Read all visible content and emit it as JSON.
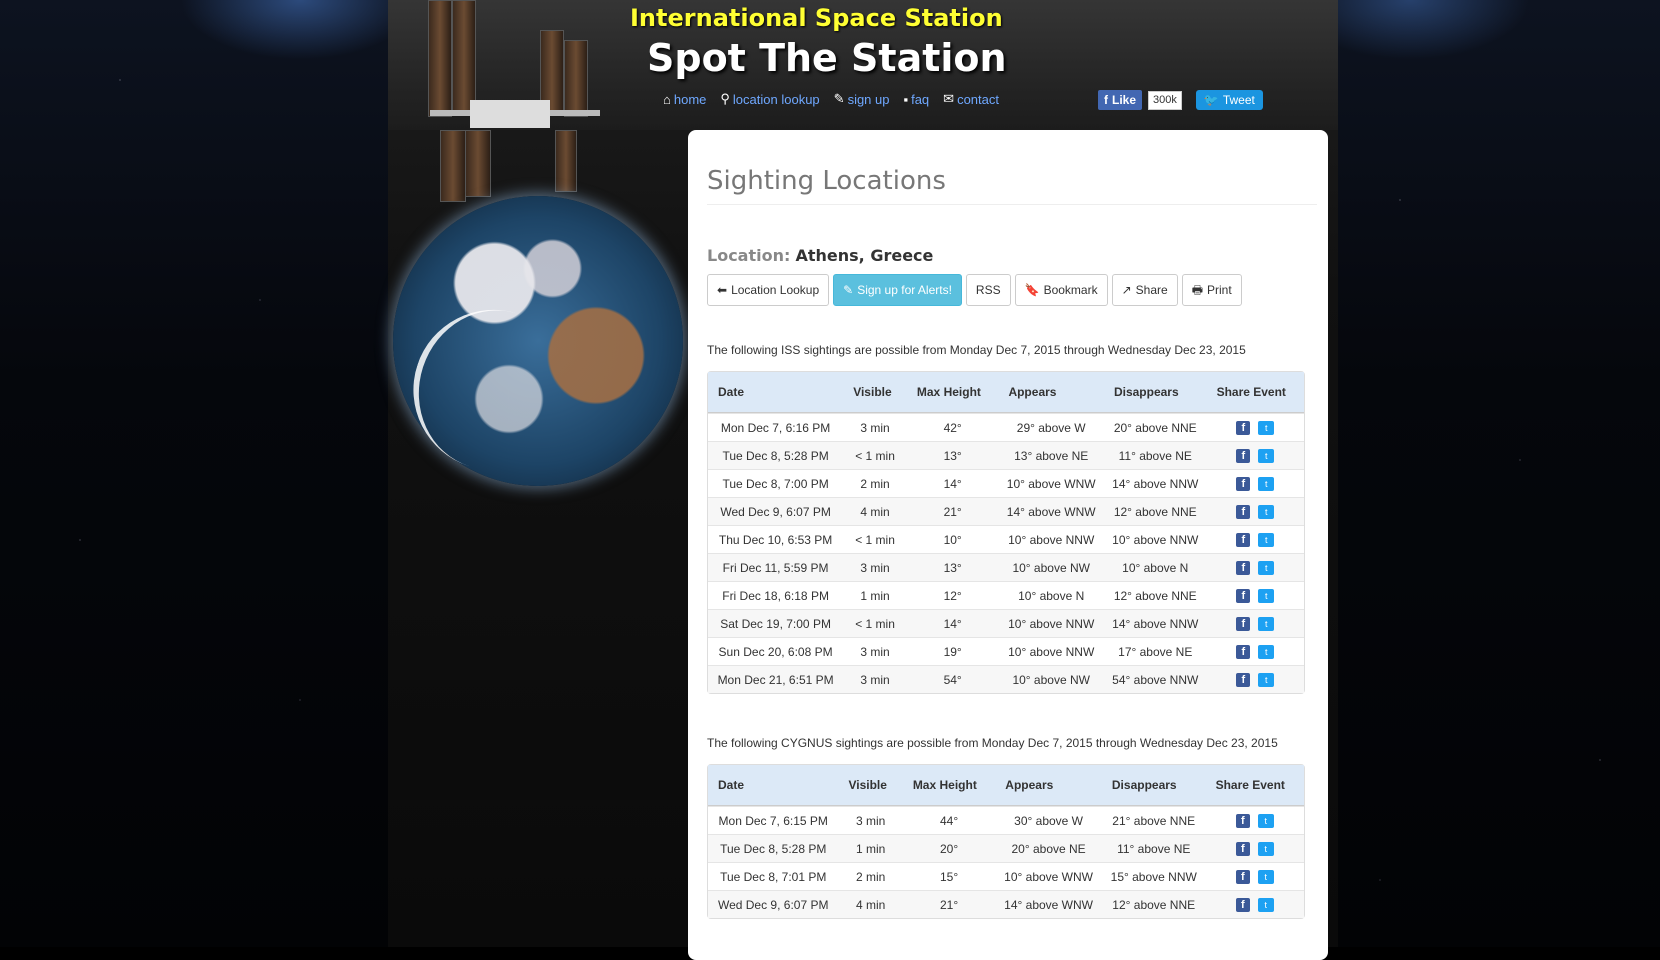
{
  "header": {
    "site_title": "International Space Station",
    "site_subtitle": "Spot The Station"
  },
  "nav": [
    {
      "label": "home",
      "icon": "home-icon"
    },
    {
      "label": "location lookup",
      "icon": "map-marker-icon"
    },
    {
      "label": "sign up",
      "icon": "pencil-icon"
    },
    {
      "label": "faq",
      "icon": "comment-icon"
    },
    {
      "label": "contact",
      "icon": "envelope-icon"
    }
  ],
  "social": {
    "like_label": "Like",
    "like_count": "300k",
    "tweet_label": "Tweet"
  },
  "page": {
    "title": "Sighting Locations",
    "location_label": "Location:",
    "location_value": "Athens, Greece"
  },
  "actions": {
    "location_lookup": "Location Lookup",
    "signup_alerts": "Sign up for Alerts!",
    "rss": "RSS",
    "bookmark": "Bookmark",
    "share": "Share",
    "print": "Print"
  },
  "iss": {
    "intro": "The following ISS sightings are possible from Monday Dec 7, 2015 through Wednesday Dec 23, 2015",
    "headers": [
      "Date",
      "Visible",
      "Max Height",
      "Appears",
      "Disappears",
      "Share Event"
    ],
    "rows": [
      [
        "Mon Dec 7, 6:16 PM",
        "3 min",
        "42°",
        "29° above W",
        "20° above NNE"
      ],
      [
        "Tue Dec 8, 5:28 PM",
        "< 1 min",
        "13°",
        "13° above NE",
        "11° above NE"
      ],
      [
        "Tue Dec 8, 7:00 PM",
        "2 min",
        "14°",
        "10° above WNW",
        "14° above NNW"
      ],
      [
        "Wed Dec 9, 6:07 PM",
        "4 min",
        "21°",
        "14° above WNW",
        "12° above NNE"
      ],
      [
        "Thu Dec 10, 6:53 PM",
        "< 1 min",
        "10°",
        "10° above NNW",
        "10° above NNW"
      ],
      [
        "Fri Dec 11, 5:59 PM",
        "3 min",
        "13°",
        "10° above NW",
        "10° above N"
      ],
      [
        "Fri Dec 18, 6:18 PM",
        "1 min",
        "12°",
        "10° above N",
        "12° above NNE"
      ],
      [
        "Sat Dec 19, 7:00 PM",
        "< 1 min",
        "14°",
        "10° above NNW",
        "14° above NNW"
      ],
      [
        "Sun Dec 20, 6:08 PM",
        "3 min",
        "19°",
        "10° above NNW",
        "17° above NE"
      ],
      [
        "Mon Dec 21, 6:51 PM",
        "3 min",
        "54°",
        "10° above NW",
        "54° above NNW"
      ]
    ]
  },
  "cygnus": {
    "intro": "The following CYGNUS sightings are possible from Monday Dec 7, 2015 through Wednesday Dec 23, 2015",
    "headers": [
      "Date",
      "Visible",
      "Max Height",
      "Appears",
      "Disappears",
      "Share Event"
    ],
    "rows": [
      [
        "Mon Dec 7, 6:15 PM",
        "3 min",
        "44°",
        "30° above W",
        "21° above NNE"
      ],
      [
        "Tue Dec 8, 5:28 PM",
        "1 min",
        "20°",
        "20° above NE",
        "11° above NE"
      ],
      [
        "Tue Dec 8, 7:01 PM",
        "2 min",
        "15°",
        "10° above WNW",
        "15° above NNW"
      ],
      [
        "Wed Dec 9, 6:07 PM",
        "4 min",
        "21°",
        "14° above WNW",
        "12° above NNE"
      ]
    ]
  },
  "colors": {
    "title_yellow": "#ffff33",
    "nav_link": "#6fa8ff",
    "alert_button": "#5bc0de",
    "table_header": "#dce9f7",
    "facebook": "#3b5998",
    "twitter": "#1da1f2"
  }
}
